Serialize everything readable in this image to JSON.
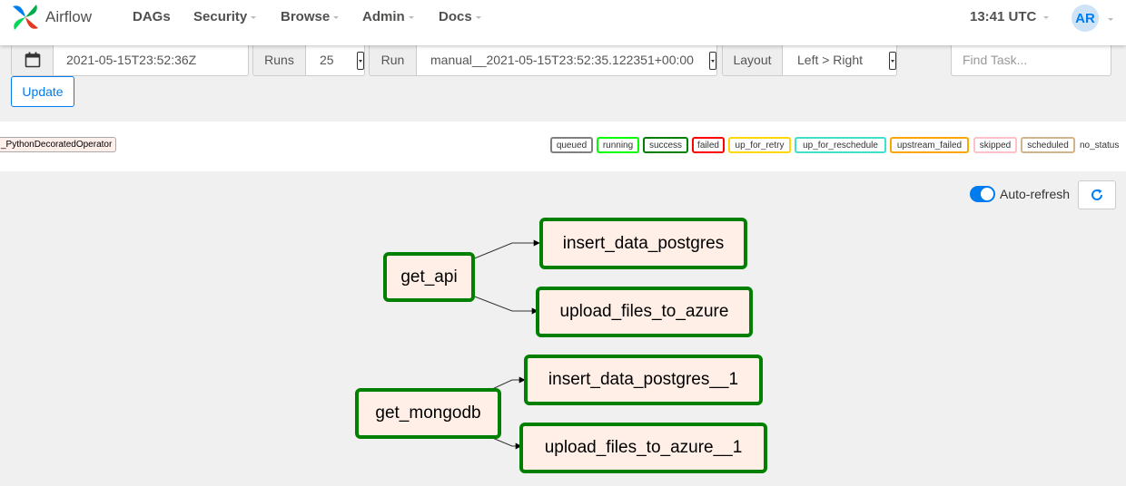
{
  "navbar": {
    "brand": "Airflow",
    "items": [
      {
        "label": "DAGs",
        "dropdown": false
      },
      {
        "label": "Security",
        "dropdown": true
      },
      {
        "label": "Browse",
        "dropdown": true
      },
      {
        "label": "Admin",
        "dropdown": true
      },
      {
        "label": "Docs",
        "dropdown": true
      }
    ],
    "time": "13:41 UTC",
    "user_initials": "AR"
  },
  "controls": {
    "base_date": "2021-05-15T23:52:36Z",
    "runs_label": "Runs",
    "runs_value": "25",
    "run_label": "Run",
    "run_value": "manual__2021-05-15T23:52:35.122351+00:00",
    "layout_label": "Layout",
    "layout_value": "Left > Right",
    "find_placeholder": "Find Task...",
    "update_label": "Update"
  },
  "legend": {
    "operator": "_PythonDecoratedOperator",
    "states": [
      {
        "label": "queued",
        "color": "#808080"
      },
      {
        "label": "running",
        "color": "#00ff00"
      },
      {
        "label": "success",
        "color": "#008000"
      },
      {
        "label": "failed",
        "color": "#ff0000"
      },
      {
        "label": "up_for_retry",
        "color": "#ffd700"
      },
      {
        "label": "up_for_reschedule",
        "color": "#40e0d0"
      },
      {
        "label": "upstream_failed",
        "color": "#ffa500"
      },
      {
        "label": "skipped",
        "color": "#ffc0cb"
      },
      {
        "label": "scheduled",
        "color": "#d2b48c"
      }
    ],
    "no_status": "no_status"
  },
  "graph": {
    "auto_refresh_label": "Auto-refresh",
    "auto_refresh_on": true,
    "node_state_color": "#008000",
    "node_fill": "#ffefe7",
    "nodes": {
      "get_api": "get_api",
      "insert_data_postgres": "insert_data_postgres",
      "upload_files_to_azure": "upload_files_to_azure",
      "get_mongodb": "get_mongodb",
      "insert_data_postgres__1": "insert_data_postgres__1",
      "upload_files_to_azure__1": "upload_files_to_azure__1"
    },
    "edges": [
      [
        "get_api",
        "insert_data_postgres"
      ],
      [
        "get_api",
        "upload_files_to_azure"
      ],
      [
        "get_mongodb",
        "insert_data_postgres__1"
      ],
      [
        "get_mongodb",
        "upload_files_to_azure__1"
      ]
    ]
  }
}
